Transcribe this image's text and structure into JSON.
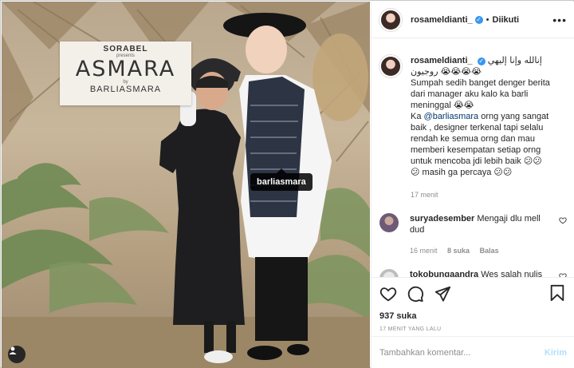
{
  "post": {
    "username": "rosameldianti_",
    "verified_icon": "verified-badge-icon",
    "follow_label": "Diikuti",
    "separator": "•",
    "more_label": "•••",
    "photo_tag": "barliasmara",
    "sign": {
      "brand": "SORABEL",
      "presents": "presents",
      "title": "ASMARA",
      "by": "by",
      "designer": "BARLIASMARA"
    }
  },
  "caption": {
    "username": "rosameldianti_",
    "arabic": "إنالله وإنا إليهي روجيون",
    "emoji_line1": "😭😭😭😭",
    "text1": "Sumpah sedih banget denger berita dari manager aku kalo ka barli meninggal",
    "emoji_line2": "😭😭",
    "text2_prefix": "Ka",
    "mention": "@barliasmara",
    "text2": "orng yang sangat baik , designer terkenal tapi selalu rendah ke semua orng dan mau memberi kesempatan setiap orng untuk mencoba jdi lebih baik",
    "emoji_line3": "😕😕",
    "emoji_line4": "😕",
    "text3": "masih ga percaya",
    "emoji_line5": "😕😕",
    "time": "17 menit"
  },
  "comments": [
    {
      "username": "suryadesember",
      "text": "Mengaji dlu mell dud",
      "time": "16 menit",
      "likes": "8 suka",
      "reply": "Balas"
    },
    {
      "username": "tokobungaandra",
      "text": "Wes salah nulis"
    }
  ],
  "actions": {
    "likes": "937 suka",
    "time_ago": "17 MENIT YANG LALU"
  },
  "comment_box": {
    "placeholder": "Tambahkan komentar...",
    "send_label": "Kirim"
  },
  "colors": {
    "verified": "#3897f0",
    "mention": "#00376b",
    "send_disabled": "#b2dffc",
    "muted": "#8e8e8e"
  }
}
